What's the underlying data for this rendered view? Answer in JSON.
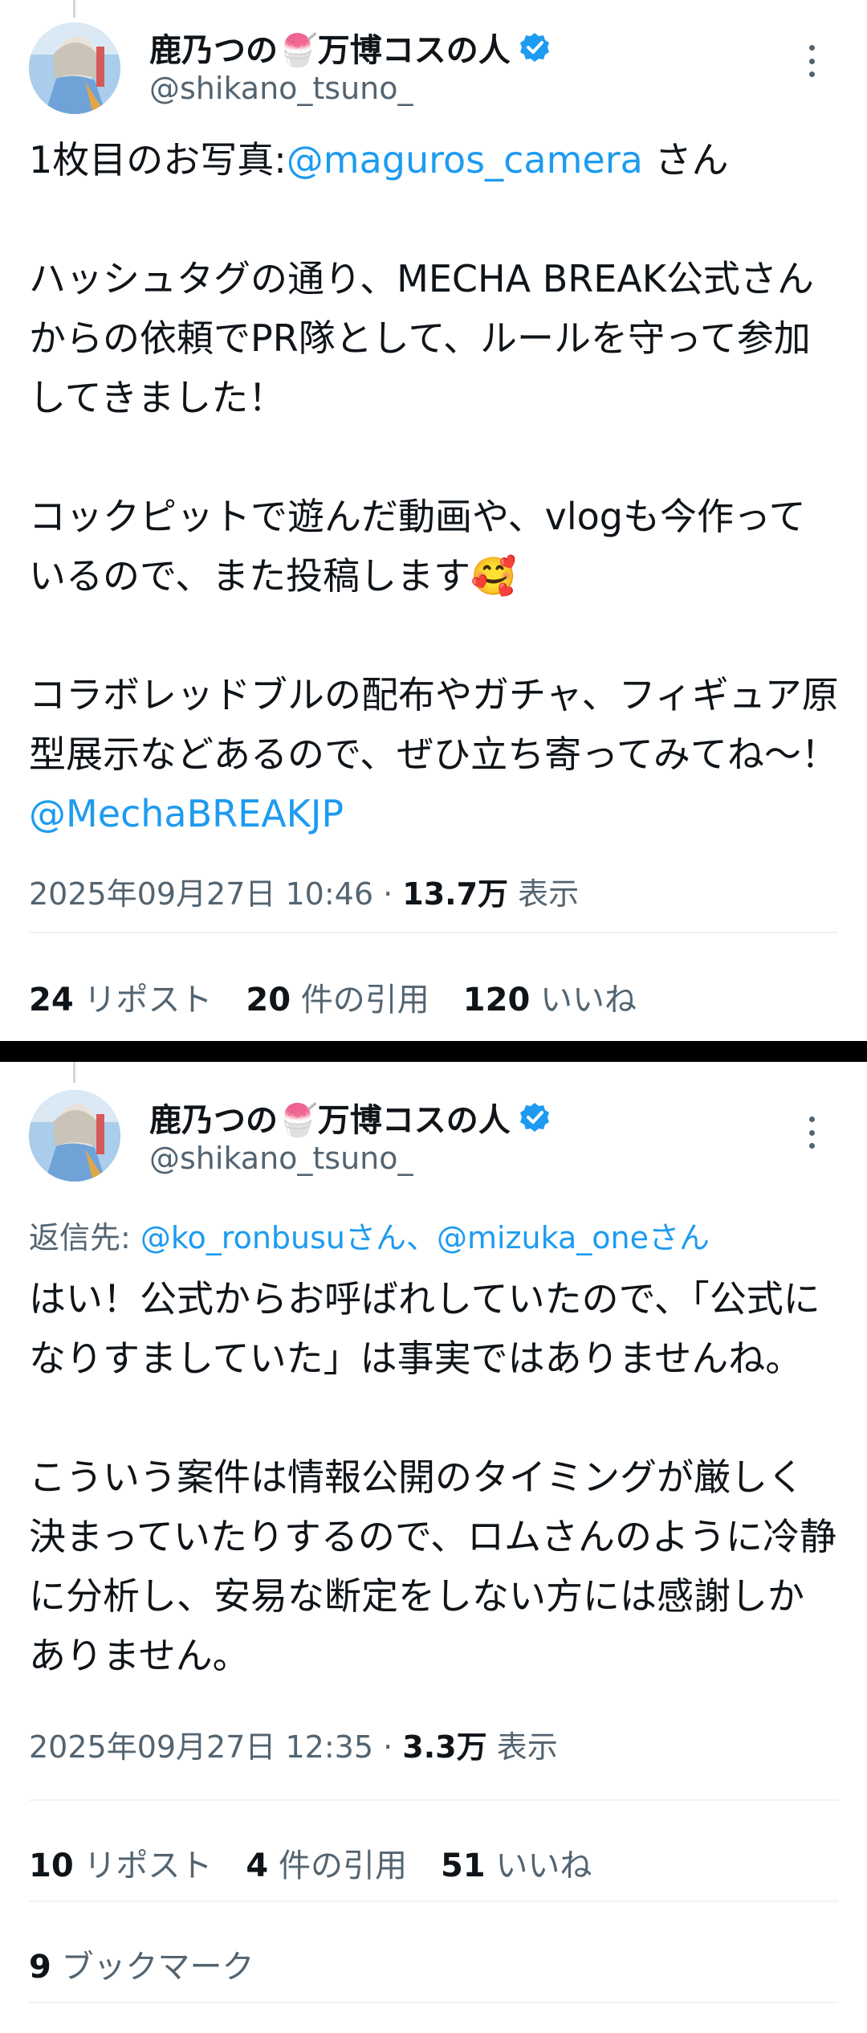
{
  "tweet1": {
    "author": {
      "display_name": "鹿乃つの🍧万博コスの人",
      "handle": "@shikano_tsuno_"
    },
    "body": [
      {
        "text": "1枚目のお写真:"
      },
      {
        "text": "@maguros_camera",
        "mention": true
      },
      {
        "text": " さん\n\nハッシュタグの通り、MECHA BREAK公式さんからの依頼でPR隊として、ルールを守って参加してきました！\n\nコックピットで遊んだ動画や、vlogも今作っているので、また投稿します🥰\n\nコラボレッドブルの配布やガチャ、フィギュア原型展示などあるので、ぜひ立ち寄ってみてね〜！\n"
      },
      {
        "text": "@MechaBREAKJP",
        "mention": true
      }
    ],
    "timestamp": "2025年09月27日 10:46",
    "views_count": "13.7万",
    "views_label": "表示",
    "reposts": {
      "count": "24",
      "label": "リポスト"
    },
    "quotes": {
      "count": "20",
      "label": "件の引用"
    },
    "likes": {
      "count": "120",
      "label": "いいね"
    }
  },
  "tweet2": {
    "author": {
      "display_name": "鹿乃つの🍧万博コスの人",
      "handle": "@shikano_tsuno_"
    },
    "reply_to": {
      "prefix": "返信先: ",
      "users": [
        "@ko_ronbusuさん",
        "@mizuka_oneさん"
      ],
      "separator": "、"
    },
    "body": "はい！公式からお呼ばれしていたので、「公式になりすましていた」は事実ではありませんね。\n\nこういう案件は情報公開のタイミングが厳しく決まっていたりするので、ロムさんのように冷静に分析し、安易な断定をしない方には感謝しかありません。",
    "timestamp": "2025年09月27日 12:35",
    "views_count": "3.3万",
    "views_label": "表示",
    "reposts": {
      "count": "10",
      "label": "リポスト"
    },
    "quotes": {
      "count": "4",
      "label": "件の引用"
    },
    "likes": {
      "count": "51",
      "label": "いいね"
    },
    "bookmarks": {
      "count": "9",
      "label": "ブックマーク"
    }
  },
  "colors": {
    "accent": "#1d9bf0",
    "text": "#0f1419",
    "muted": "#536471",
    "divider": "#eff3f4"
  }
}
